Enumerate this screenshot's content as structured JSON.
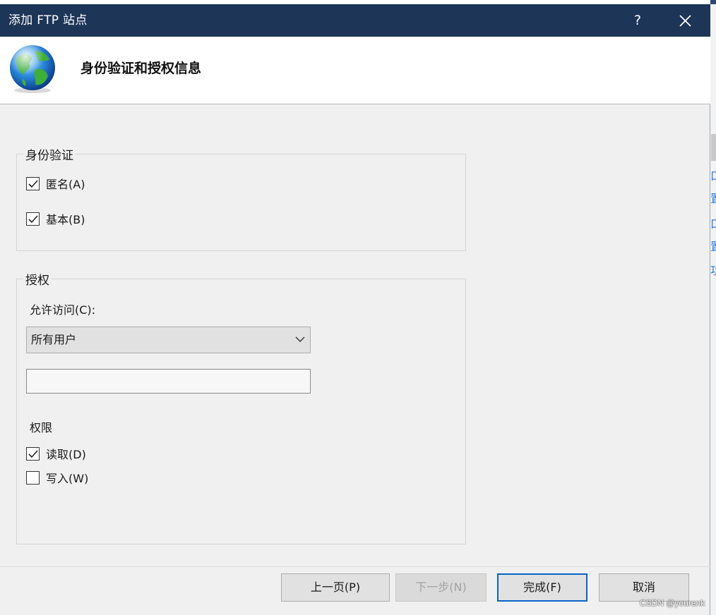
{
  "window": {
    "title": "添加 FTP 站点",
    "help_label": "?"
  },
  "header": {
    "heading": "身份验证和授权信息"
  },
  "authentication": {
    "legend": "身份验证",
    "anonymous": {
      "label": "匿名(A)",
      "checked": true
    },
    "basic": {
      "label": "基本(B)",
      "checked": true
    }
  },
  "authorization": {
    "legend": "授权",
    "allow_access_label": "允许访问(C):",
    "allow_access_selected": "所有用户",
    "user_input_value": "",
    "permissions_label": "权限",
    "read": {
      "label": "读取(D)",
      "checked": true
    },
    "write": {
      "label": "写入(W)",
      "checked": false
    }
  },
  "buttons": {
    "previous": "上一页(P)",
    "next": "下一步(N)",
    "finish": "完成(F)",
    "cancel": "取消"
  },
  "background_app": {
    "glyphs": [
      "口",
      "置",
      "口",
      "置",
      "功"
    ]
  },
  "watermark": "CSDN @yourenk",
  "colors": {
    "titlebar": "#1d3557",
    "dialog_bg": "#f0f0f0",
    "accent_focus": "#0a64c8",
    "link_blue": "#2d7bd6"
  }
}
